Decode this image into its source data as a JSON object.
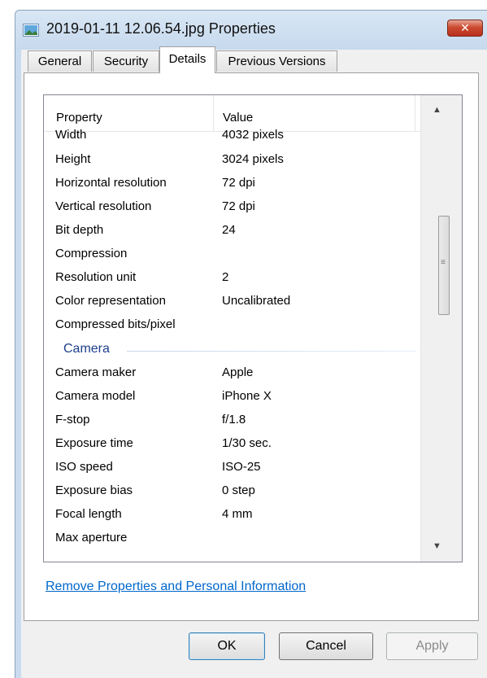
{
  "window": {
    "title": "2019-01-11 12.06.54.jpg Properties",
    "close_glyph": "✕"
  },
  "tabs": [
    {
      "label": "General",
      "active": false
    },
    {
      "label": "Security",
      "active": false
    },
    {
      "label": "Details",
      "active": true
    },
    {
      "label": "Previous Versions",
      "active": false
    }
  ],
  "details": {
    "column_headers": {
      "property": "Property",
      "value": "Value"
    },
    "image_rows": [
      {
        "property": "Width",
        "value": "4032 pixels"
      },
      {
        "property": "Height",
        "value": "3024 pixels"
      },
      {
        "property": "Horizontal resolution",
        "value": "72 dpi"
      },
      {
        "property": "Vertical resolution",
        "value": "72 dpi"
      },
      {
        "property": "Bit depth",
        "value": "24"
      },
      {
        "property": "Compression",
        "value": ""
      },
      {
        "property": "Resolution unit",
        "value": "2"
      },
      {
        "property": "Color representation",
        "value": "Uncalibrated"
      },
      {
        "property": "Compressed bits/pixel",
        "value": ""
      }
    ],
    "camera_group_label": "Camera",
    "camera_rows": [
      {
        "property": "Camera maker",
        "value": "Apple"
      },
      {
        "property": "Camera model",
        "value": "iPhone X"
      },
      {
        "property": "F-stop",
        "value": "f/1.8"
      },
      {
        "property": "Exposure time",
        "value": "1/30 sec."
      },
      {
        "property": "ISO speed",
        "value": "ISO-25"
      },
      {
        "property": "Exposure bias",
        "value": "0 step"
      },
      {
        "property": "Focal length",
        "value": "4 mm"
      },
      {
        "property": "Max aperture",
        "value": ""
      }
    ]
  },
  "remove_link": "Remove Properties and Personal Information",
  "buttons": {
    "ok": "OK",
    "cancel": "Cancel",
    "apply": "Apply"
  },
  "colors": {
    "close_button": "#c8432b",
    "group_label": "#1e3f8a",
    "link": "#0066cc"
  }
}
